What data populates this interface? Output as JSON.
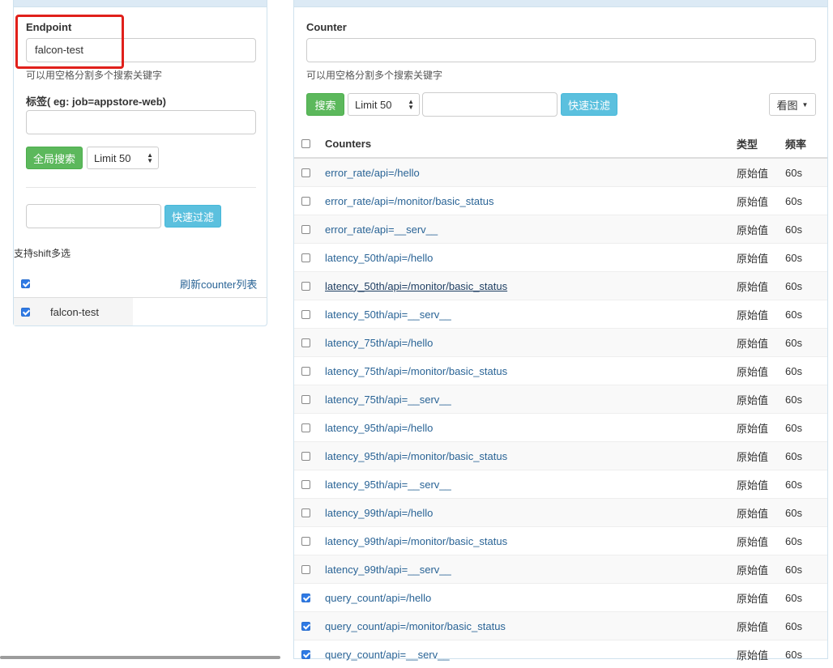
{
  "left": {
    "endpoint_label": "Endpoint",
    "endpoint_value": "falcon-test",
    "endpoint_hint": "可以用空格分割多个搜索关键字",
    "tag_label": "标签( eg: job=appstore-web)",
    "tag_value": "",
    "global_search_button": "全局搜索",
    "limit_select": "Limit 50",
    "filter_value": "",
    "filter_button": "快速过滤",
    "shift_hint": "支持shift多选",
    "refresh_link": "刷新counter列表",
    "endpoints": [
      {
        "name": "falcon-test",
        "checked": true
      }
    ]
  },
  "right": {
    "counter_label": "Counter",
    "counter_value": "",
    "counter_hint": "可以用空格分割多个搜索关键字",
    "search_button": "搜索",
    "limit_select": "Limit 50",
    "filter_value": "",
    "filter_button": "快速过滤",
    "view_button": "看图",
    "table": {
      "headers": {
        "counters": "Counters",
        "type": "类型",
        "freq": "频率"
      },
      "rows": [
        {
          "name": "error_rate/api=/hello",
          "type": "原始值",
          "freq": "60s",
          "checked": false
        },
        {
          "name": "error_rate/api=/monitor/basic_status",
          "type": "原始值",
          "freq": "60s",
          "checked": false
        },
        {
          "name": "error_rate/api=__serv__",
          "type": "原始值",
          "freq": "60s",
          "checked": false
        },
        {
          "name": "latency_50th/api=/hello",
          "type": "原始值",
          "freq": "60s",
          "checked": false
        },
        {
          "name": "latency_50th/api=/monitor/basic_status",
          "type": "原始值",
          "freq": "60s",
          "checked": false
        },
        {
          "name": "latency_50th/api=__serv__",
          "type": "原始值",
          "freq": "60s",
          "checked": false
        },
        {
          "name": "latency_75th/api=/hello",
          "type": "原始值",
          "freq": "60s",
          "checked": false
        },
        {
          "name": "latency_75th/api=/monitor/basic_status",
          "type": "原始值",
          "freq": "60s",
          "checked": false
        },
        {
          "name": "latency_75th/api=__serv__",
          "type": "原始值",
          "freq": "60s",
          "checked": false
        },
        {
          "name": "latency_95th/api=/hello",
          "type": "原始值",
          "freq": "60s",
          "checked": false
        },
        {
          "name": "latency_95th/api=/monitor/basic_status",
          "type": "原始值",
          "freq": "60s",
          "checked": false
        },
        {
          "name": "latency_95th/api=__serv__",
          "type": "原始值",
          "freq": "60s",
          "checked": false
        },
        {
          "name": "latency_99th/api=/hello",
          "type": "原始值",
          "freq": "60s",
          "checked": false
        },
        {
          "name": "latency_99th/api=/monitor/basic_status",
          "type": "原始值",
          "freq": "60s",
          "checked": false
        },
        {
          "name": "latency_99th/api=__serv__",
          "type": "原始值",
          "freq": "60s",
          "checked": false
        },
        {
          "name": "query_count/api=/hello",
          "type": "原始值",
          "freq": "60s",
          "checked": true
        },
        {
          "name": "query_count/api=/monitor/basic_status",
          "type": "原始值",
          "freq": "60s",
          "checked": true
        },
        {
          "name": "query_count/api=__serv__",
          "type": "原始值",
          "freq": "60s",
          "checked": true
        }
      ]
    }
  },
  "colors": {
    "green": "#5cb85c",
    "blue": "#5bc0de",
    "link": "#2a6496",
    "highlight": "#e0201b",
    "checkbox": "#2f7ae5"
  }
}
